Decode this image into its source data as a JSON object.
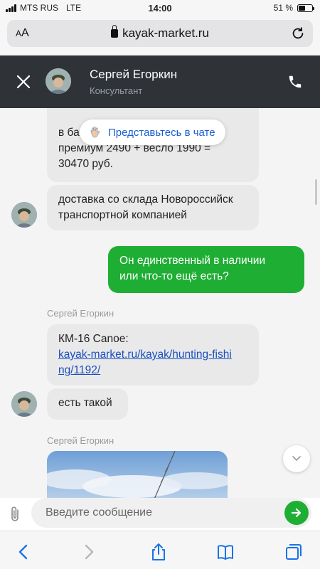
{
  "status_bar": {
    "carrier": "MTS RUS",
    "network": "LTE",
    "time": "14:00",
    "battery_percent": "51 %",
    "battery_level": 0.51
  },
  "browser": {
    "text_size_label": "AA",
    "url": "kayak-market.ru",
    "icons": [
      "lock-icon",
      "reload-icon",
      "back-arrow-icon",
      "forward-arrow-icon",
      "share-icon",
      "bookmarks-icon",
      "tabs-icon"
    ]
  },
  "header": {
    "agent_name": "Сергей Егоркин",
    "agent_role": "Консультант"
  },
  "intro_prompt": "Представьтесь в чате",
  "messages": [
    {
      "text_line1": "в ба",
      "text_line2": "премиум 2490 + весло 1990 =",
      "text_line3": "30470 руб."
    },
    {
      "text_line1": "доставка со склада Новороссийск",
      "text_line2": "транспортной компанией"
    },
    {
      "text_line1": "Он единственный в наличии",
      "text_line2": "или что-то ещё есть?"
    },
    {
      "sender": "Сергей Егоркин",
      "text_line1": "КМ-16 Canoe:",
      "link_line1": "kayak-market.ru/kayak/hunting-fishi",
      "link_line2": "ng/1192/"
    },
    {
      "text_line1": "есть такой"
    },
    {
      "sender": "Сергей Егоркин"
    }
  ],
  "composer": {
    "placeholder": "Введите сообщение"
  },
  "colors": {
    "header_bg": "#2f3338",
    "outgoing_bubble": "#1fae34",
    "incoming_bubble": "#e9e9e9",
    "link": "#1a4fbf"
  }
}
